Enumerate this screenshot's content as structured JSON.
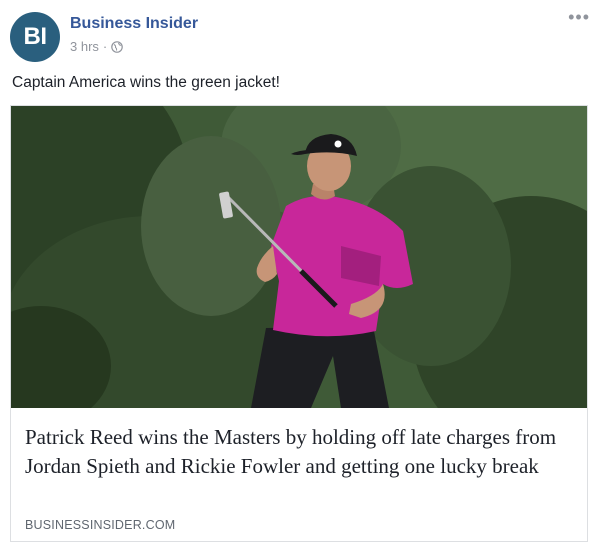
{
  "post": {
    "avatar_text": "BI",
    "page_name": "Business Insider",
    "timestamp": "3 hrs",
    "separator": "·",
    "audience_icon": "globe-icon",
    "more_icon": "ellipsis-icon",
    "more_label": "•••",
    "caption": "Captain America wins the green jacket!"
  },
  "link_card": {
    "image_description_icon": "photo",
    "headline": "Patrick Reed wins the Masters by holding off late charges from Jordan Spieth and Rickie Fowler and getting one lucky break",
    "domain": "BUSINESSINSIDER.COM"
  },
  "colors": {
    "brand_avatar": "#2a5f7e",
    "page_name": "#365899",
    "muted": "#90949c",
    "shirt": "#c8279a"
  }
}
